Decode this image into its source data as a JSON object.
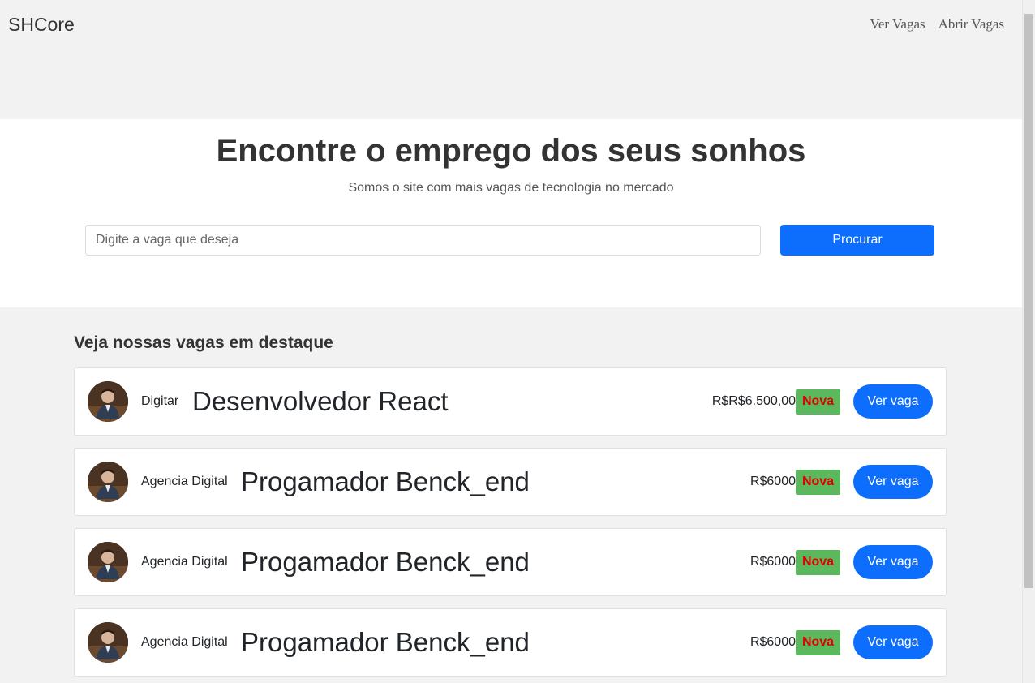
{
  "nav": {
    "brand": "SHCore",
    "links": [
      "Ver Vagas",
      "Abrir Vagas"
    ]
  },
  "hero": {
    "title": "Encontre o emprego dos seus sonhos",
    "subtitle": "Somos o site com mais vagas de tecnologia no mercado",
    "search_placeholder": "Digite a vaga que deseja",
    "search_value": "",
    "search_button": "Procurar"
  },
  "jobs_section": {
    "title": "Veja nossas vagas em destaque",
    "jobs": [
      {
        "company": "Digitar",
        "title": "Desenvolvedor React",
        "salary": "R$R$6.500,00",
        "badge": "Nova",
        "button": "Ver vaga",
        "avatar_icon": "person-avatar"
      },
      {
        "company": "Agencia Digital",
        "title": "Progamador Benck_end",
        "salary": "R$6000",
        "badge": "Nova",
        "button": "Ver vaga",
        "avatar_icon": "person-avatar"
      },
      {
        "company": "Agencia Digital",
        "title": "Progamador Benck_end",
        "salary": "R$6000",
        "badge": "Nova",
        "button": "Ver vaga",
        "avatar_icon": "person-avatar"
      },
      {
        "company": "Agencia Digital",
        "title": "Progamador Benck_end",
        "salary": "R$6000",
        "badge": "Nova",
        "button": "Ver vaga",
        "avatar_icon": "person-avatar"
      }
    ]
  },
  "colors": {
    "primary": "#0d6efd",
    "badge_bg": "#5cb85c",
    "badge_text": "#e00000"
  }
}
